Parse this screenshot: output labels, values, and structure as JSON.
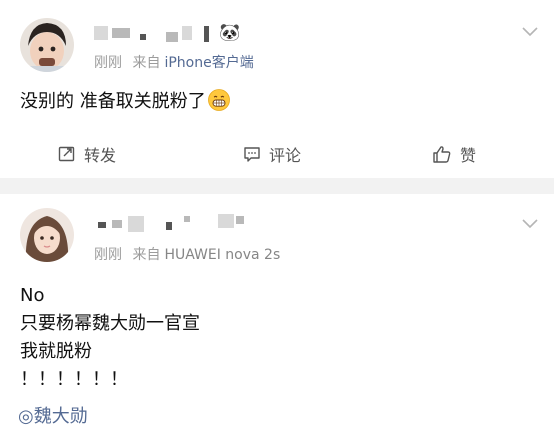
{
  "post1": {
    "username_emoji": "🐼",
    "time": "刚刚",
    "source_prefix": "来自",
    "source": "iPhone客户端",
    "content": "没别的 准备取关脱粉了",
    "actions": {
      "repost": "转发",
      "comment": "评论",
      "like": "赞"
    }
  },
  "post2": {
    "time": "刚刚",
    "source_prefix": "来自",
    "source": "HUAWEI nova 2s",
    "lines": [
      "No",
      "只要杨幂魏大勋一官宣",
      "我就脱粉",
      "！！！！！！"
    ],
    "partial_mention": "◎魏大勋"
  },
  "icons": [
    "repost-icon",
    "comment-icon",
    "like-icon",
    "chevron-down-icon",
    "grin-emoji-icon"
  ],
  "colors": {
    "link": "#546a93",
    "meta": "#9c9c9c",
    "separator": "#f2f2f2"
  }
}
